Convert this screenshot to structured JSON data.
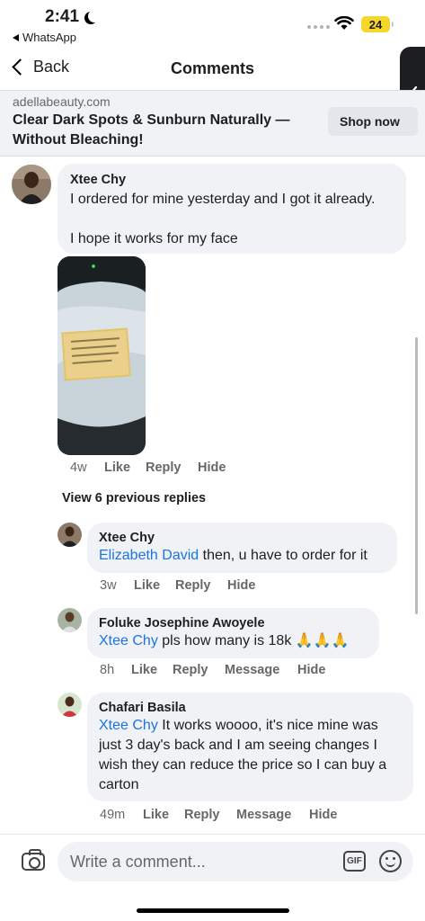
{
  "status": {
    "time": "2:41",
    "back_app": "WhatsApp",
    "battery": "24"
  },
  "nav": {
    "back_label": "Back",
    "title": "Comments"
  },
  "ad": {
    "domain": "adellabeauty.com",
    "headline": "Clear Dark Spots & Sunburn Naturally — Without Bleaching!",
    "cta": "Shop now"
  },
  "main_comment": {
    "author": "Xtee Chy",
    "text_line1": "I ordered for mine yesterday and I got it already.",
    "text_line2": "I hope it works for my face",
    "time": "4w",
    "like": "Like",
    "reply": "Reply",
    "hide": "Hide"
  },
  "view_previous": "View 6 previous replies",
  "replies": [
    {
      "author": "Xtee Chy",
      "mention": "Elizabeth David",
      "text": " then, u have to order for it",
      "time": "3w",
      "like": "Like",
      "reply": "Reply",
      "hide": "Hide"
    },
    {
      "author": "Foluke Josephine Awoyele",
      "mention": "Xtee Chy",
      "text": " pls how many is 18k 🙏🙏🙏",
      "time": "8h",
      "like": "Like",
      "reply": "Reply",
      "message": "Message",
      "hide": "Hide"
    },
    {
      "author": "Chafari Basila",
      "mention": "Xtee Chy",
      "text": " It works woooo, it's nice mine was just 3 day's back and I am seeing changes I wish they can reduce the price so I can buy a carton",
      "time": "49m",
      "like": "Like",
      "reply": "Reply",
      "message": "Message",
      "hide": "Hide"
    }
  ],
  "composer": {
    "placeholder": "Write a comment...",
    "gif_label": "GIF"
  },
  "icons": {
    "back": "chevron-left-icon",
    "camera": "camera-icon",
    "gif": "gif-icon",
    "emoji": "emoji-icon",
    "wifi": "wifi-icon"
  },
  "colors": {
    "accent": "#1b74e4",
    "bubble": "#f0f2f5",
    "battery": "#f7d62c"
  }
}
